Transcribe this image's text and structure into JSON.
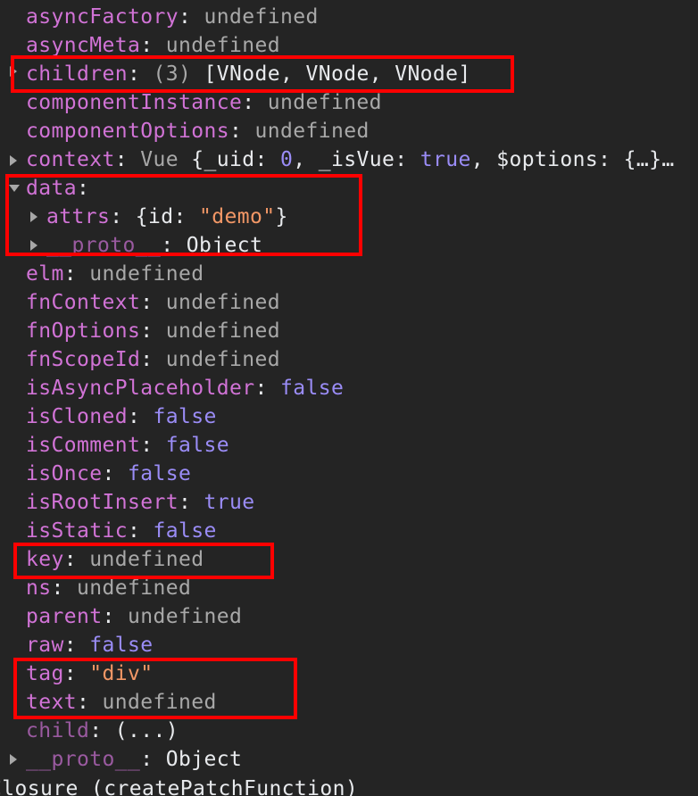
{
  "props": {
    "asyncFactory": {
      "key": "asyncFactory",
      "value": "undefined"
    },
    "asyncMeta": {
      "key": "asyncMeta",
      "value": "undefined"
    },
    "children": {
      "key": "children",
      "count": "(3)",
      "value": "[VNode, VNode, VNode]"
    },
    "componentInstance": {
      "key": "componentInstance",
      "value": "undefined"
    },
    "componentOptions": {
      "key": "componentOptions",
      "value": "undefined"
    },
    "context": {
      "key": "context",
      "class": "Vue",
      "p1": "{_uid: ",
      "p1v": "0",
      "p2": ", _isVue: ",
      "p2v": "true",
      "p3": ", $options: {…}…"
    },
    "data": {
      "key": "data"
    },
    "attrs": {
      "key": "attrs",
      "open": "{id: ",
      "val": "\"demo\"",
      "close": "}"
    },
    "data_proto": {
      "key": "__proto__",
      "value": "Object"
    },
    "elm": {
      "key": "elm",
      "value": "undefined"
    },
    "fnContext": {
      "key": "fnContext",
      "value": "undefined"
    },
    "fnOptions": {
      "key": "fnOptions",
      "value": "undefined"
    },
    "fnScopeId": {
      "key": "fnScopeId",
      "value": "undefined"
    },
    "isAsyncPlaceholder": {
      "key": "isAsyncPlaceholder",
      "value": "false"
    },
    "isCloned": {
      "key": "isCloned",
      "value": "false"
    },
    "isComment": {
      "key": "isComment",
      "value": "false"
    },
    "isOnce": {
      "key": "isOnce",
      "value": "false"
    },
    "isRootInsert": {
      "key": "isRootInsert",
      "value": "true"
    },
    "isStatic": {
      "key": "isStatic",
      "value": "false"
    },
    "keyProp": {
      "key": "key",
      "value": "undefined"
    },
    "ns": {
      "key": "ns",
      "value": "undefined"
    },
    "parent": {
      "key": "parent",
      "value": "undefined"
    },
    "raw": {
      "key": "raw",
      "value": "false"
    },
    "tag": {
      "key": "tag",
      "value": "\"div\""
    },
    "text": {
      "key": "text",
      "value": "undefined"
    },
    "child": {
      "key": "child",
      "value": "(...)"
    },
    "proto": {
      "key": "__proto__",
      "value": "Object"
    },
    "closure": {
      "value": "Closure (createPatchFunction)"
    }
  },
  "colors": {
    "background": "#242424",
    "key": "#d173d6",
    "undefined": "#a8a8a8",
    "boolean": "#9a8cf6",
    "string": "#f29766",
    "highlight": "#ff0000"
  }
}
